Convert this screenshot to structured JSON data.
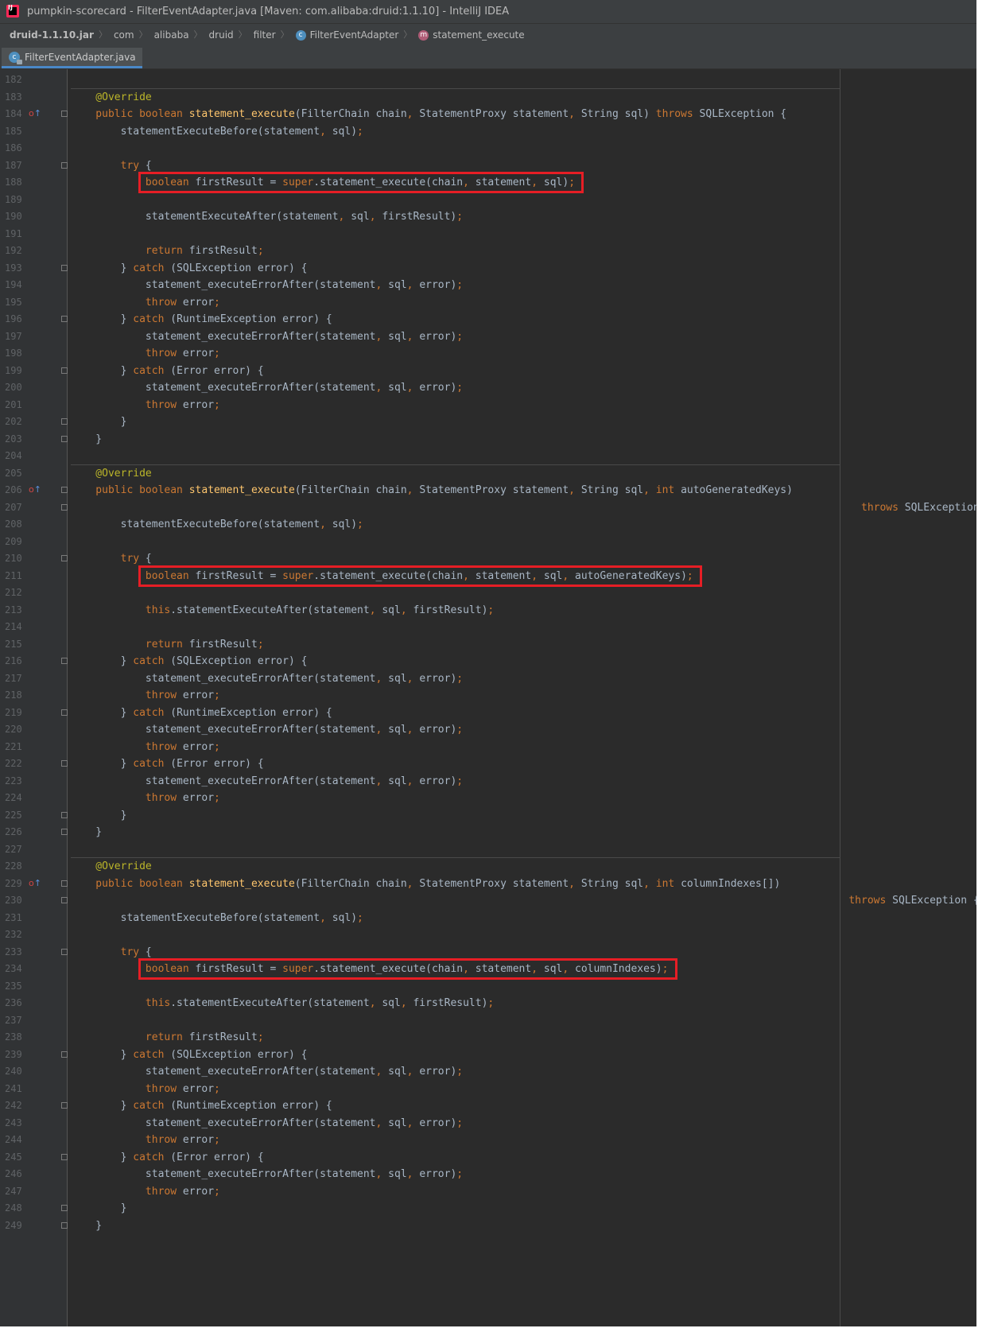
{
  "window": {
    "title": "pumpkin-scorecard - FilterEventAdapter.java [Maven: com.alibaba:druid:1.1.10] - IntelliJ IDEA",
    "app_icon_text": "IJ"
  },
  "breadcrumb": [
    {
      "label": "druid-1.1.10.jar",
      "icon": ""
    },
    {
      "label": "com",
      "icon": ""
    },
    {
      "label": "alibaba",
      "icon": ""
    },
    {
      "label": "druid",
      "icon": ""
    },
    {
      "label": "filter",
      "icon": ""
    },
    {
      "label": "FilterEventAdapter",
      "icon": "class-icon"
    },
    {
      "label": "statement_execute",
      "icon": "method-icon"
    }
  ],
  "tabs": [
    {
      "label": "FilterEventAdapter.java",
      "active": true,
      "icon": "java-class-icon"
    }
  ],
  "colors": {
    "keyword": "#cc7832",
    "method_declaration": "#ffc66d",
    "annotation": "#bbb529",
    "plain_text": "#a9b7c6",
    "line_number": "#606366",
    "highlight_box": "#e61e25",
    "editor_background": "#2b2b2b"
  },
  "gutter_marks": [
    {
      "line": 184,
      "icon": "override-marker-icon"
    },
    {
      "line": 206,
      "icon": "override-marker-icon"
    },
    {
      "line": 229,
      "icon": "override-marker-icon"
    }
  ],
  "highlighted_lines": [
    188,
    211,
    234
  ],
  "code_lines": [
    {
      "n": "182",
      "s": [],
      "fold": false
    },
    {
      "n": "183",
      "s": [
        [
          "a",
          "    @Override"
        ]
      ],
      "fold": false,
      "sep": true
    },
    {
      "n": "184",
      "s": [
        [
          "k",
          "    public boolean "
        ],
        [
          "f",
          "statement_execute"
        ],
        [
          "p",
          "(FilterChain chain"
        ],
        [
          "k",
          ", "
        ],
        [
          "p",
          "StatementProxy statement"
        ],
        [
          "k",
          ", "
        ],
        [
          "p",
          "String sql) "
        ],
        [
          "k",
          "throws "
        ],
        [
          "p",
          "SQLException {"
        ]
      ],
      "fold": true
    },
    {
      "n": "185",
      "s": [
        [
          "p",
          "        statementExecuteBefore(statement"
        ],
        [
          "k",
          ", "
        ],
        [
          "p",
          "sql)"
        ],
        [
          "k",
          ";"
        ]
      ],
      "fold": false
    },
    {
      "n": "186",
      "s": [],
      "fold": false
    },
    {
      "n": "187",
      "s": [
        [
          "k",
          "        try "
        ],
        [
          "p",
          "{"
        ]
      ],
      "fold": true
    },
    {
      "n": "188",
      "s": [
        [
          "k",
          "            boolean "
        ],
        [
          "p",
          "firstResult = "
        ],
        [
          "k",
          "super"
        ],
        [
          "p",
          ".statement_execute(chain"
        ],
        [
          "k",
          ", "
        ],
        [
          "p",
          "statement"
        ],
        [
          "k",
          ", "
        ],
        [
          "p",
          "sql)"
        ],
        [
          "k",
          ";"
        ]
      ],
      "fold": false
    },
    {
      "n": "189",
      "s": [],
      "fold": false
    },
    {
      "n": "190",
      "s": [
        [
          "p",
          "            statementExecuteAfter(statement"
        ],
        [
          "k",
          ", "
        ],
        [
          "p",
          "sql"
        ],
        [
          "k",
          ", "
        ],
        [
          "p",
          "firstResult)"
        ],
        [
          "k",
          ";"
        ]
      ],
      "fold": false
    },
    {
      "n": "191",
      "s": [],
      "fold": false
    },
    {
      "n": "192",
      "s": [
        [
          "k",
          "            return "
        ],
        [
          "p",
          "firstResult"
        ],
        [
          "k",
          ";"
        ]
      ],
      "fold": false
    },
    {
      "n": "193",
      "s": [
        [
          "p",
          "        } "
        ],
        [
          "k",
          "catch "
        ],
        [
          "p",
          "(SQLException error) {"
        ]
      ],
      "fold": true
    },
    {
      "n": "194",
      "s": [
        [
          "p",
          "            statement_executeErrorAfter(statement"
        ],
        [
          "k",
          ", "
        ],
        [
          "p",
          "sql"
        ],
        [
          "k",
          ", "
        ],
        [
          "p",
          "error)"
        ],
        [
          "k",
          ";"
        ]
      ],
      "fold": false
    },
    {
      "n": "195",
      "s": [
        [
          "k",
          "            throw "
        ],
        [
          "p",
          "error"
        ],
        [
          "k",
          ";"
        ]
      ],
      "fold": false
    },
    {
      "n": "196",
      "s": [
        [
          "p",
          "        } "
        ],
        [
          "k",
          "catch "
        ],
        [
          "p",
          "(RuntimeException error) {"
        ]
      ],
      "fold": true
    },
    {
      "n": "197",
      "s": [
        [
          "p",
          "            statement_executeErrorAfter(statement"
        ],
        [
          "k",
          ", "
        ],
        [
          "p",
          "sql"
        ],
        [
          "k",
          ", "
        ],
        [
          "p",
          "error)"
        ],
        [
          "k",
          ";"
        ]
      ],
      "fold": false
    },
    {
      "n": "198",
      "s": [
        [
          "k",
          "            throw "
        ],
        [
          "p",
          "error"
        ],
        [
          "k",
          ";"
        ]
      ],
      "fold": false
    },
    {
      "n": "199",
      "s": [
        [
          "p",
          "        } "
        ],
        [
          "k",
          "catch "
        ],
        [
          "p",
          "(Error error) {"
        ]
      ],
      "fold": true
    },
    {
      "n": "200",
      "s": [
        [
          "p",
          "            statement_executeErrorAfter(statement"
        ],
        [
          "k",
          ", "
        ],
        [
          "p",
          "sql"
        ],
        [
          "k",
          ", "
        ],
        [
          "p",
          "error)"
        ],
        [
          "k",
          ";"
        ]
      ],
      "fold": false
    },
    {
      "n": "201",
      "s": [
        [
          "k",
          "            throw "
        ],
        [
          "p",
          "error"
        ],
        [
          "k",
          ";"
        ]
      ],
      "fold": false
    },
    {
      "n": "202",
      "s": [
        [
          "p",
          "        }"
        ]
      ],
      "fold": true
    },
    {
      "n": "203",
      "s": [
        [
          "p",
          "    }"
        ]
      ],
      "fold": true
    },
    {
      "n": "204",
      "s": [],
      "fold": false
    },
    {
      "n": "205",
      "s": [
        [
          "a",
          "    @Override"
        ]
      ],
      "fold": false,
      "sep": true
    },
    {
      "n": "206",
      "s": [
        [
          "k",
          "    public boolean "
        ],
        [
          "f",
          "statement_execute"
        ],
        [
          "p",
          "(FilterChain chain"
        ],
        [
          "k",
          ", "
        ],
        [
          "p",
          "StatementProxy statement"
        ],
        [
          "k",
          ", "
        ],
        [
          "p",
          "String sql"
        ],
        [
          "k",
          ", int "
        ],
        [
          "p",
          "autoGeneratedKeys)"
        ]
      ],
      "fold": true
    },
    {
      "n": "207",
      "s": [
        [
          "k",
          "                                                                                                                               throws "
        ],
        [
          "p",
          "SQLException {"
        ]
      ],
      "fold": true
    },
    {
      "n": "208",
      "s": [
        [
          "p",
          "        statementExecuteBefore(statement"
        ],
        [
          "k",
          ", "
        ],
        [
          "p",
          "sql)"
        ],
        [
          "k",
          ";"
        ]
      ],
      "fold": false
    },
    {
      "n": "209",
      "s": [],
      "fold": false
    },
    {
      "n": "210",
      "s": [
        [
          "k",
          "        try "
        ],
        [
          "p",
          "{"
        ]
      ],
      "fold": true
    },
    {
      "n": "211",
      "s": [
        [
          "k",
          "            boolean "
        ],
        [
          "p",
          "firstResult = "
        ],
        [
          "k",
          "super"
        ],
        [
          "p",
          ".statement_execute(chain"
        ],
        [
          "k",
          ", "
        ],
        [
          "p",
          "statement"
        ],
        [
          "k",
          ", "
        ],
        [
          "p",
          "sql"
        ],
        [
          "k",
          ", "
        ],
        [
          "p",
          "autoGeneratedKeys)"
        ],
        [
          "k",
          ";"
        ]
      ],
      "fold": false
    },
    {
      "n": "212",
      "s": [],
      "fold": false
    },
    {
      "n": "213",
      "s": [
        [
          "k",
          "            this"
        ],
        [
          "p",
          ".statementExecuteAfter(statement"
        ],
        [
          "k",
          ", "
        ],
        [
          "p",
          "sql"
        ],
        [
          "k",
          ", "
        ],
        [
          "p",
          "firstResult)"
        ],
        [
          "k",
          ";"
        ]
      ],
      "fold": false
    },
    {
      "n": "214",
      "s": [],
      "fold": false
    },
    {
      "n": "215",
      "s": [
        [
          "k",
          "            return "
        ],
        [
          "p",
          "firstResult"
        ],
        [
          "k",
          ";"
        ]
      ],
      "fold": false
    },
    {
      "n": "216",
      "s": [
        [
          "p",
          "        } "
        ],
        [
          "k",
          "catch "
        ],
        [
          "p",
          "(SQLException error) {"
        ]
      ],
      "fold": true
    },
    {
      "n": "217",
      "s": [
        [
          "p",
          "            statement_executeErrorAfter(statement"
        ],
        [
          "k",
          ", "
        ],
        [
          "p",
          "sql"
        ],
        [
          "k",
          ", "
        ],
        [
          "p",
          "error)"
        ],
        [
          "k",
          ";"
        ]
      ],
      "fold": false
    },
    {
      "n": "218",
      "s": [
        [
          "k",
          "            throw "
        ],
        [
          "p",
          "error"
        ],
        [
          "k",
          ";"
        ]
      ],
      "fold": false
    },
    {
      "n": "219",
      "s": [
        [
          "p",
          "        } "
        ],
        [
          "k",
          "catch "
        ],
        [
          "p",
          "(RuntimeException error) {"
        ]
      ],
      "fold": true
    },
    {
      "n": "220",
      "s": [
        [
          "p",
          "            statement_executeErrorAfter(statement"
        ],
        [
          "k",
          ", "
        ],
        [
          "p",
          "sql"
        ],
        [
          "k",
          ", "
        ],
        [
          "p",
          "error)"
        ],
        [
          "k",
          ";"
        ]
      ],
      "fold": false
    },
    {
      "n": "221",
      "s": [
        [
          "k",
          "            throw "
        ],
        [
          "p",
          "error"
        ],
        [
          "k",
          ";"
        ]
      ],
      "fold": false
    },
    {
      "n": "222",
      "s": [
        [
          "p",
          "        } "
        ],
        [
          "k",
          "catch "
        ],
        [
          "p",
          "(Error error) {"
        ]
      ],
      "fold": true
    },
    {
      "n": "223",
      "s": [
        [
          "p",
          "            statement_executeErrorAfter(statement"
        ],
        [
          "k",
          ", "
        ],
        [
          "p",
          "sql"
        ],
        [
          "k",
          ", "
        ],
        [
          "p",
          "error)"
        ],
        [
          "k",
          ";"
        ]
      ],
      "fold": false
    },
    {
      "n": "224",
      "s": [
        [
          "k",
          "            throw "
        ],
        [
          "p",
          "error"
        ],
        [
          "k",
          ";"
        ]
      ],
      "fold": false
    },
    {
      "n": "225",
      "s": [
        [
          "p",
          "        }"
        ]
      ],
      "fold": true
    },
    {
      "n": "226",
      "s": [
        [
          "p",
          "    }"
        ]
      ],
      "fold": true
    },
    {
      "n": "227",
      "s": [],
      "fold": false
    },
    {
      "n": "228",
      "s": [
        [
          "a",
          "    @Override"
        ]
      ],
      "fold": false,
      "sep": true
    },
    {
      "n": "229",
      "s": [
        [
          "k",
          "    public boolean "
        ],
        [
          "f",
          "statement_execute"
        ],
        [
          "p",
          "(FilterChain chain"
        ],
        [
          "k",
          ", "
        ],
        [
          "p",
          "StatementProxy statement"
        ],
        [
          "k",
          ", "
        ],
        [
          "p",
          "String sql"
        ],
        [
          "k",
          ", int "
        ],
        [
          "p",
          "columnIndexes[])"
        ]
      ],
      "fold": true
    },
    {
      "n": "230",
      "s": [
        [
          "k",
          "                                                                                                                             throws "
        ],
        [
          "p",
          "SQLException {"
        ]
      ],
      "fold": true
    },
    {
      "n": "231",
      "s": [
        [
          "p",
          "        statementExecuteBefore(statement"
        ],
        [
          "k",
          ", "
        ],
        [
          "p",
          "sql)"
        ],
        [
          "k",
          ";"
        ]
      ],
      "fold": false
    },
    {
      "n": "232",
      "s": [],
      "fold": false
    },
    {
      "n": "233",
      "s": [
        [
          "k",
          "        try "
        ],
        [
          "p",
          "{"
        ]
      ],
      "fold": true
    },
    {
      "n": "234",
      "s": [
        [
          "k",
          "            boolean "
        ],
        [
          "p",
          "firstResult = "
        ],
        [
          "k",
          "super"
        ],
        [
          "p",
          ".statement_execute(chain"
        ],
        [
          "k",
          ", "
        ],
        [
          "p",
          "statement"
        ],
        [
          "k",
          ", "
        ],
        [
          "p",
          "sql"
        ],
        [
          "k",
          ", "
        ],
        [
          "p",
          "columnIndexes)"
        ],
        [
          "k",
          ";"
        ]
      ],
      "fold": false
    },
    {
      "n": "235",
      "s": [],
      "fold": false
    },
    {
      "n": "236",
      "s": [
        [
          "k",
          "            this"
        ],
        [
          "p",
          ".statementExecuteAfter(statement"
        ],
        [
          "k",
          ", "
        ],
        [
          "p",
          "sql"
        ],
        [
          "k",
          ", "
        ],
        [
          "p",
          "firstResult)"
        ],
        [
          "k",
          ";"
        ]
      ],
      "fold": false
    },
    {
      "n": "237",
      "s": [],
      "fold": false
    },
    {
      "n": "238",
      "s": [
        [
          "k",
          "            return "
        ],
        [
          "p",
          "firstResult"
        ],
        [
          "k",
          ";"
        ]
      ],
      "fold": false
    },
    {
      "n": "239",
      "s": [
        [
          "p",
          "        } "
        ],
        [
          "k",
          "catch "
        ],
        [
          "p",
          "(SQLException error) {"
        ]
      ],
      "fold": true
    },
    {
      "n": "240",
      "s": [
        [
          "p",
          "            statement_executeErrorAfter(statement"
        ],
        [
          "k",
          ", "
        ],
        [
          "p",
          "sql"
        ],
        [
          "k",
          ", "
        ],
        [
          "p",
          "error)"
        ],
        [
          "k",
          ";"
        ]
      ],
      "fold": false
    },
    {
      "n": "241",
      "s": [
        [
          "k",
          "            throw "
        ],
        [
          "p",
          "error"
        ],
        [
          "k",
          ";"
        ]
      ],
      "fold": false
    },
    {
      "n": "242",
      "s": [
        [
          "p",
          "        } "
        ],
        [
          "k",
          "catch "
        ],
        [
          "p",
          "(RuntimeException error) {"
        ]
      ],
      "fold": true
    },
    {
      "n": "243",
      "s": [
        [
          "p",
          "            statement_executeErrorAfter(statement"
        ],
        [
          "k",
          ", "
        ],
        [
          "p",
          "sql"
        ],
        [
          "k",
          ", "
        ],
        [
          "p",
          "error)"
        ],
        [
          "k",
          ";"
        ]
      ],
      "fold": false
    },
    {
      "n": "244",
      "s": [
        [
          "k",
          "            throw "
        ],
        [
          "p",
          "error"
        ],
        [
          "k",
          ";"
        ]
      ],
      "fold": false
    },
    {
      "n": "245",
      "s": [
        [
          "p",
          "        } "
        ],
        [
          "k",
          "catch "
        ],
        [
          "p",
          "(Error error) {"
        ]
      ],
      "fold": true
    },
    {
      "n": "246",
      "s": [
        [
          "p",
          "            statement_executeErrorAfter(statement"
        ],
        [
          "k",
          ", "
        ],
        [
          "p",
          "sql"
        ],
        [
          "k",
          ", "
        ],
        [
          "p",
          "error)"
        ],
        [
          "k",
          ";"
        ]
      ],
      "fold": false
    },
    {
      "n": "247",
      "s": [
        [
          "k",
          "            throw "
        ],
        [
          "p",
          "error"
        ],
        [
          "k",
          ";"
        ]
      ],
      "fold": false
    },
    {
      "n": "248",
      "s": [
        [
          "p",
          "        }"
        ]
      ],
      "fold": true
    },
    {
      "n": "249",
      "s": [
        [
          "p",
          "    }"
        ]
      ],
      "fold": true
    }
  ]
}
